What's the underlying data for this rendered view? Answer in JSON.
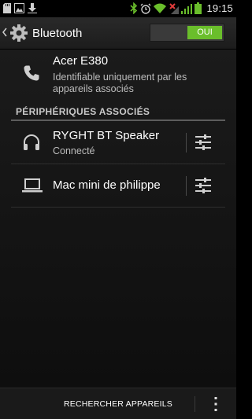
{
  "status_bar": {
    "time": "19:15",
    "left_icons": [
      "sd-card-icon",
      "image-icon",
      "download-icon"
    ],
    "right_icons": [
      "bluetooth-icon",
      "alarm-icon",
      "wifi-icon",
      "no-signal-icon",
      "signal-bars-icon",
      "battery-icon"
    ]
  },
  "action_bar": {
    "title": "Bluetooth",
    "toggle_label": "OUI"
  },
  "this_device": {
    "name": "Acer E380",
    "visibility": "Identifiable uniquement par les appareils associés"
  },
  "paired_section": {
    "header": "PÉRIPHÉRIQUES ASSOCIÉS",
    "devices": [
      {
        "name": "RYGHT BT Speaker",
        "status": "Connecté",
        "icon": "headphones-icon"
      },
      {
        "name": "Mac mini de philippe",
        "status": "",
        "icon": "laptop-icon"
      }
    ]
  },
  "bottom_bar": {
    "scan_label": "RECHERCHER APPAREILS"
  },
  "colors": {
    "accent_green": "#6abe2b",
    "background": "#000000",
    "divider": "#5c5c5c"
  }
}
